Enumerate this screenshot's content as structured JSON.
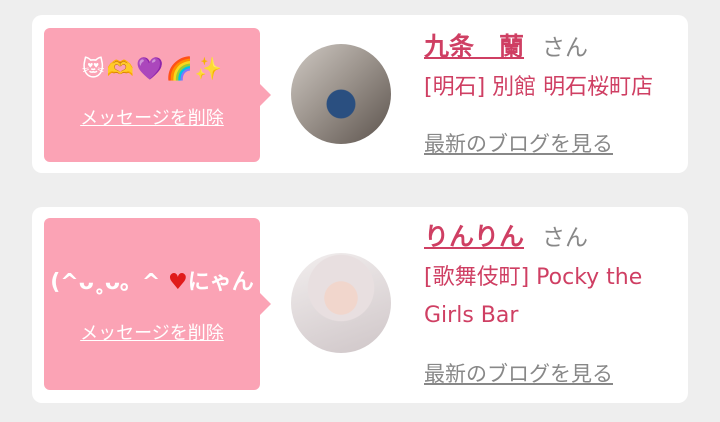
{
  "entries": [
    {
      "message_emojis": [
        "😻",
        "🫶",
        "💜",
        "🌈",
        "✨"
      ],
      "delete_label": "メッセージを削除",
      "name": "九条　蘭",
      "honorific": "さん",
      "shop": "[明石] 別館 明石桜町店",
      "blog_link": "最新のブログを見る"
    },
    {
      "message_text_before": "(^ᴗ˳ᴗ。^ ",
      "message_heart": "♥",
      "message_text_after": "にゃん",
      "delete_label": "メッセージを削除",
      "name": "りんりん",
      "honorific": "さん",
      "shop": "[歌舞伎町] Pocky the Girls Bar",
      "blog_link": "最新のブログを見る"
    }
  ],
  "colors": {
    "bubble": "#fba3b5",
    "accent": "#cf3f63",
    "muted": "#888888"
  }
}
